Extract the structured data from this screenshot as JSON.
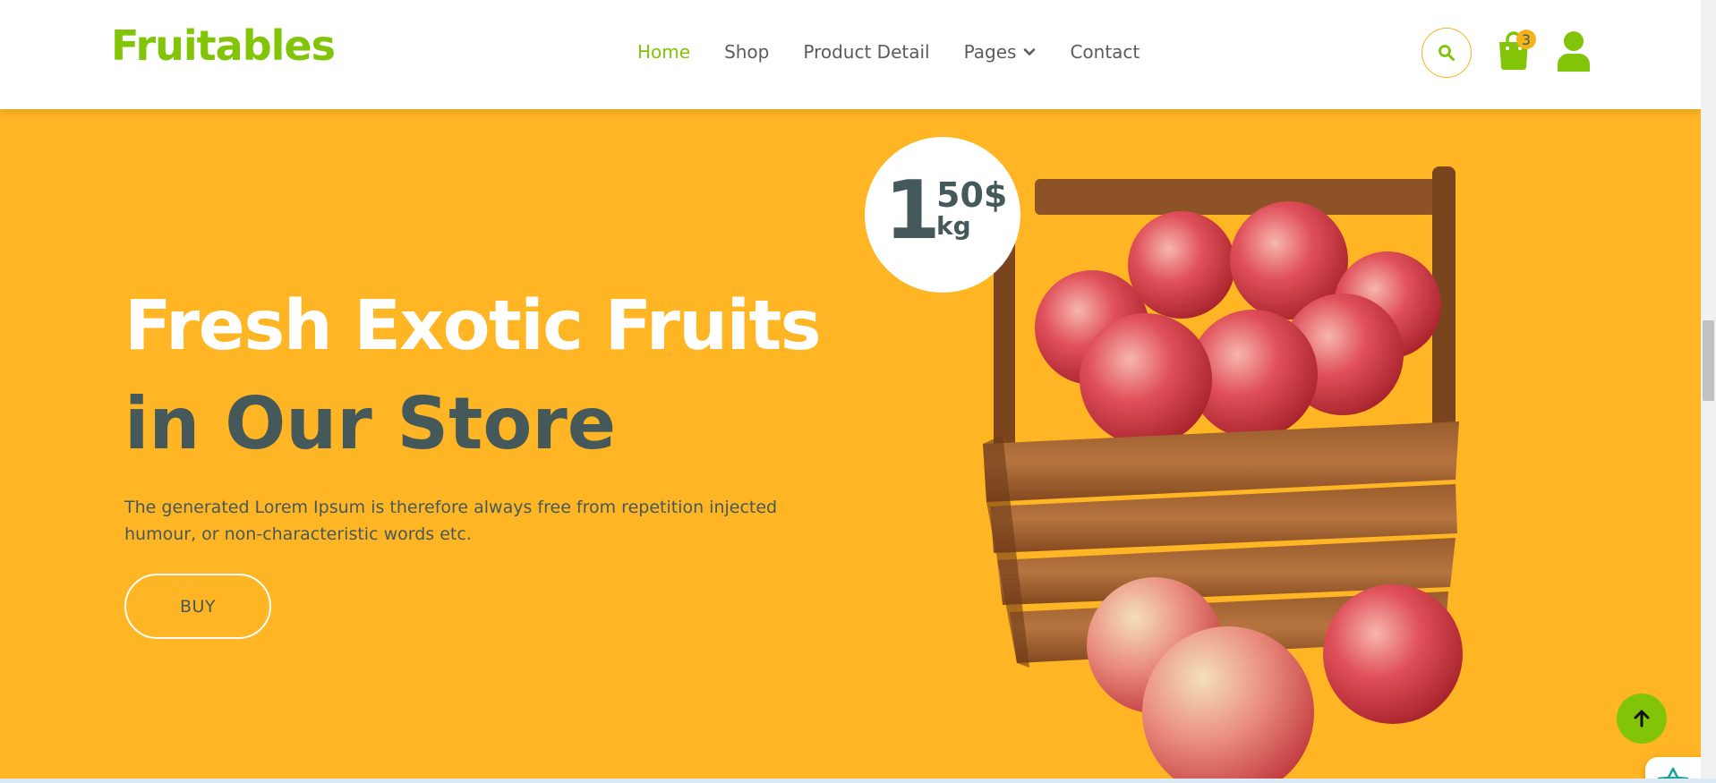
{
  "brand": {
    "logo_text": "Fruitables",
    "color": "#81c408",
    "accent": "#f5b31b"
  },
  "nav": {
    "items": [
      {
        "label": "Home",
        "active": true
      },
      {
        "label": "Shop",
        "active": false
      },
      {
        "label": "Product Detail",
        "active": false
      },
      {
        "label": "Pages",
        "active": false,
        "dropdown": true
      },
      {
        "label": "Contact",
        "active": false
      }
    ]
  },
  "header_icons": {
    "search": "search-icon",
    "cart": "shopping-bag-icon",
    "cart_count": "3",
    "user": "user-icon"
  },
  "hero": {
    "background": "#ffb524",
    "title": "Fresh Exotic Fruits",
    "subtitle": "in Our Store",
    "description": "The generated Lorem Ipsum is therefore always free from repetition injected humour, or non-characteristic words etc.",
    "button_label": "BUY",
    "price": {
      "whole": "1",
      "fraction": "50$",
      "unit": "kg"
    }
  },
  "floating": {
    "assistant": "assistant-icon",
    "back_to_top": "arrow-up-icon"
  }
}
